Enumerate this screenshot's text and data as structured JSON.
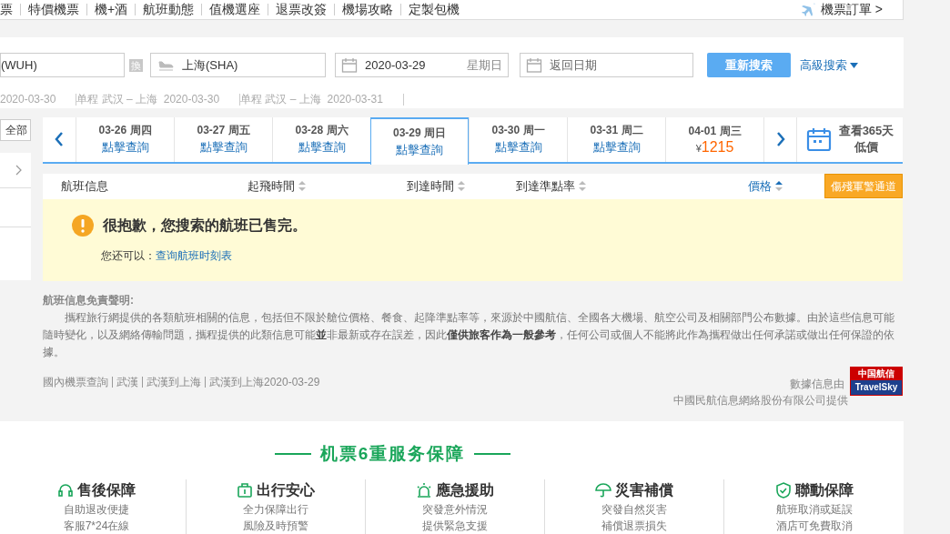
{
  "nav": {
    "items": [
      "票",
      "特價機票",
      "機+酒",
      "航班動態",
      "值機選座",
      "退票改簽",
      "機場攻略",
      "定製包機"
    ],
    "orders": "機票訂單 >"
  },
  "search": {
    "from": "(WUH)",
    "swap": "換",
    "to": "上海(SHA)",
    "depart_date": "2020-03-29",
    "depart_weekday": "星期日",
    "return_placeholder": "返回日期",
    "button": "重新搜索",
    "advanced": "高級搜索"
  },
  "history": [
    "2020-03-30",
    "单程 武汉 – 上海  2020-03-30",
    "单程 武汉 – 上海  2020-03-31"
  ],
  "sidebar": {
    "all": "全部"
  },
  "dates": [
    {
      "date": "03-26 周四",
      "kind": "link",
      "sub": "點擊查詢",
      "selected": false
    },
    {
      "date": "03-27 周五",
      "kind": "link",
      "sub": "點擊查詢",
      "selected": false
    },
    {
      "date": "03-28 周六",
      "kind": "link",
      "sub": "點擊查詢",
      "selected": false
    },
    {
      "date": "03-29 周日",
      "kind": "link",
      "sub": "點擊查詢",
      "selected": true
    },
    {
      "date": "03-30 周一",
      "kind": "link",
      "sub": "點擊查詢",
      "selected": false
    },
    {
      "date": "03-31 周二",
      "kind": "link",
      "sub": "點擊查詢",
      "selected": false
    },
    {
      "date": "04-01 周三",
      "kind": "price",
      "currency": "¥",
      "sub": "1215",
      "selected": false
    }
  ],
  "calendar": {
    "line1": "查看365天",
    "line2": "低價"
  },
  "columns": [
    {
      "label": "航班信息",
      "kind": "plain",
      "active": false
    },
    {
      "label": "起飛時間",
      "kind": "sortable",
      "active": false
    },
    {
      "label": "到達時間",
      "kind": "sortable",
      "active": false
    },
    {
      "label": "到達準點率",
      "kind": "sortable",
      "active": false
    },
    {
      "label": "價格",
      "kind": "sortable",
      "active": true
    }
  ],
  "military": "傷殘軍警通道",
  "notice": {
    "title": "很抱歉，您搜索的航班已售完。",
    "prompt": "您还可以：",
    "link": "查询航班时刻表"
  },
  "disclaimer": {
    "title": "航班信息免責聲明:",
    "body": "攜程旅行網提供的各類航班相關的信息，包括但不限於艙位價格、餐食、起降準點率等，來源於中國航信、全國各大機場、航空公司及相關部門公布數據。由於這些信息可能隨時變化，以及網絡傳輸問題，攜程提供的此類信息可能**並**非最新或存在誤差，因此**僅供旅客作為一般參考**，任何公司或個人不能將此作為攜程做出任何承諾或做出任何保證的依據。"
  },
  "footer": {
    "links": [
      "國內機票查詢",
      "武漢",
      "武漢到上海",
      "武漢到上海2020-03-29"
    ],
    "source1": "數據信息由",
    "source2": "中國民航信息網絡股份有限公司提供",
    "logo_top": "中国航信",
    "logo_bottom": "TravelSky"
  },
  "services": {
    "title": "机票6重服务保障",
    "items": [
      {
        "kind": "headset",
        "title": "售後保障",
        "lines": [
          "自助退改便捷",
          "客服7*24在線"
        ]
      },
      {
        "kind": "bag",
        "title": "出行安心",
        "lines": [
          "全力保障出行",
          "風險及時預警"
        ]
      },
      {
        "kind": "siren",
        "title": "應急援助",
        "lines": [
          "突發意外情況",
          "提供緊急支援"
        ]
      },
      {
        "kind": "umbrella",
        "title": "災害補償",
        "lines": [
          "突發自然災害",
          "補償退票損失"
        ]
      },
      {
        "kind": "shield",
        "title": "聯動保障",
        "lines": [
          "航班取消或延誤",
          "酒店可免費取消"
        ]
      }
    ]
  }
}
